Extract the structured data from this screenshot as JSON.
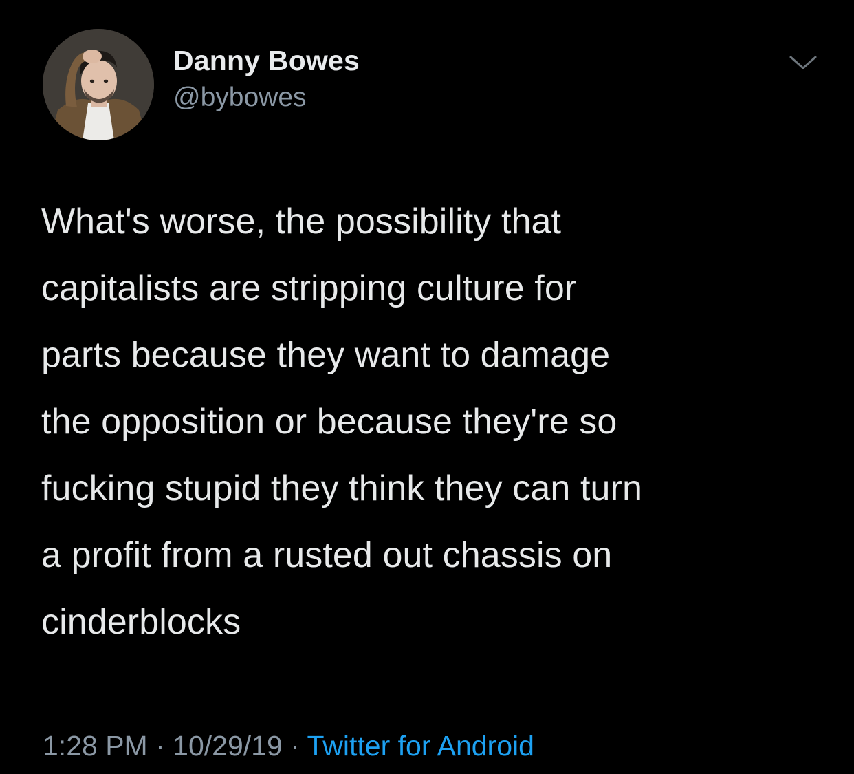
{
  "author": {
    "display_name": "Danny Bowes",
    "handle": "@bybowes"
  },
  "icons": {
    "menu": "chevron-down-icon",
    "avatar": "profile-photo"
  },
  "tweet": {
    "text": "What's worse, the possibility that\ncapitalists are stripping culture for\nparts because they want to damage\nthe opposition or because they're so\nfucking stupid they think they can turn\na profit from a rusted out chassis on\ncinderblocks"
  },
  "meta": {
    "time": "1:28 PM",
    "separator": "·",
    "date": "10/29/19",
    "source": "Twitter for Android"
  },
  "colors": {
    "background": "#000000",
    "text": "#e7e9ea",
    "secondary": "#8b98a5",
    "accent": "#1da1f2"
  }
}
